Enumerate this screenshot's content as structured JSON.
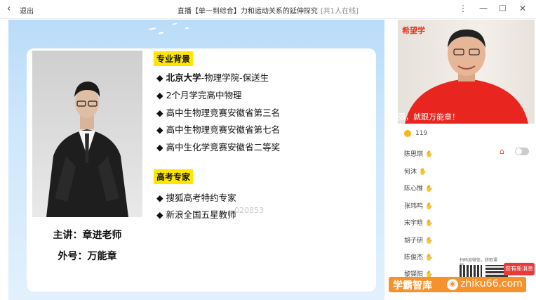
{
  "topbar": {
    "back_label": "退出",
    "title": "直播【单一到综合】力和运动关系的延伸探究",
    "online": "[共1人在线]",
    "icons": [
      "chevron-left-icon",
      "more-icon",
      "minimize-icon",
      "maximize-icon",
      "close-icon"
    ]
  },
  "slide": {
    "section1": "专业背景",
    "items1": [
      {
        "bold": "北京大学",
        "rest": "-物理学院-保送生"
      },
      {
        "bold": "",
        "rest": "2个月学完高中物理"
      },
      {
        "bold": "",
        "rest": "高中生物理竞赛安徽省第三名"
      },
      {
        "bold": "",
        "rest": "高中生物理竞赛安徽省第七名"
      },
      {
        "bold": "",
        "rest": "高中生化学竞赛安徽省二等奖"
      }
    ],
    "section2": "高考专家",
    "items2": [
      {
        "rest": "搜狐高考特约专家"
      },
      {
        "rest": "新浪全国五星教师"
      }
    ],
    "bullet": "◆",
    "teacher": "主讲：章进老师",
    "alias": "外号：万能章",
    "watermark": "020853"
  },
  "video": {
    "logo": "希望学",
    "subtitle": "强，就跟万能章！"
  },
  "chat": {
    "coin_count": "119",
    "users": [
      "陈思琪",
      "何沐",
      "陈心惟",
      "张玮鸣",
      "宋宇晗",
      "胡子研",
      "陈俊杰",
      "黎铎阳"
    ],
    "qr_text": "扫码加微信，获取课程",
    "new_message": "您有新消息"
  },
  "watermark": {
    "brand": "学霸智库",
    "url": "zhiku66.com"
  }
}
